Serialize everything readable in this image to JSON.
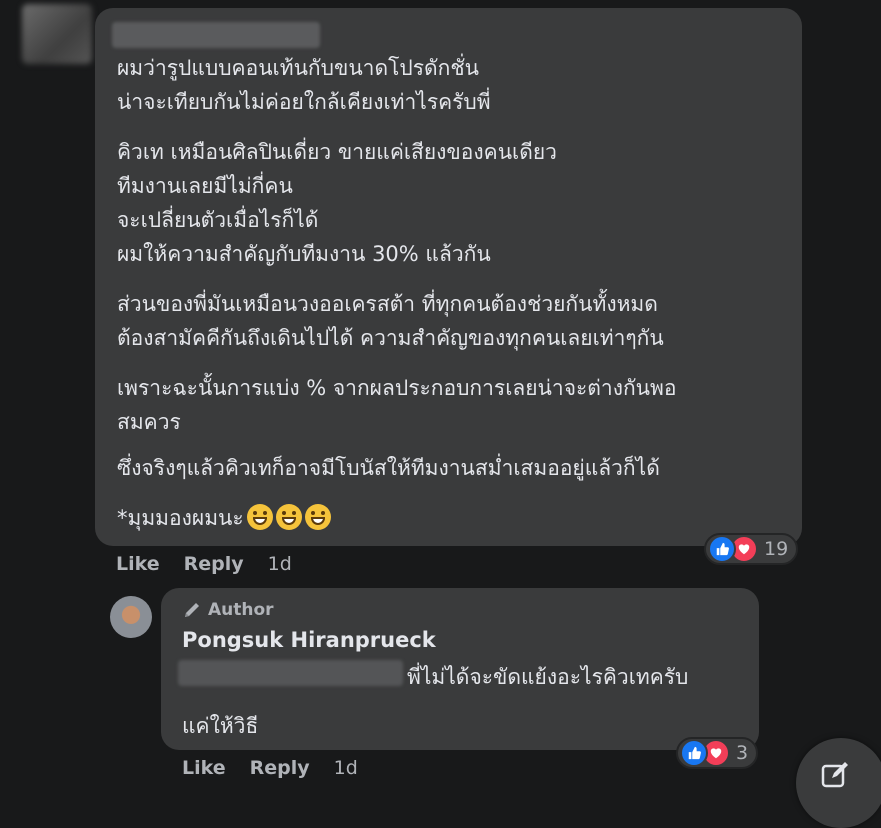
{
  "comment": {
    "paragraphs": [
      [
        "ผมว่ารูปแบบคอนเท้นกับขนาดโปรดักชั่น",
        "น่าจะเทียบกันไม่ค่อยใกล้เคียงเท่าไรครับพี่"
      ],
      [
        "คิวเท เหมือนศิลปินเดี่ยว ขายแค่เสียงของคนเดียว",
        "ทีมงานเลยมีไม่กี่คน",
        "จะเปลี่ยนตัวเมื่อไรก็ได้",
        "ผมให้ความสำคัญกับทีมงาน 30% แล้วกัน"
      ],
      [
        "ส่วนของพี่มันเหมือนวงออเครสต้า ที่ทุกคนต้องช่วยกันทั้งหมด",
        "ต้องสามัคคีกันถึงเดินไปได้ ความสำคัญของทุกคนเลยเท่าๆกัน"
      ],
      [
        "เพราะฉะนั้นการแบ่ง % จากผลประกอบการเลยน่าจะต่างกันพอ",
        "สมควร"
      ],
      [
        "ซึ่งจริงๆแล้วคิวเทก็อาจมีโบนัสให้ทีมงานสม่ำเสมออยู่แล้วก็ได้"
      ]
    ],
    "last_line": "*มุมมองผมนะ",
    "emoji": [
      "grinning-emoji",
      "grinning-emoji",
      "grinning-emoji"
    ],
    "reaction_count": "19",
    "like_label": "Like",
    "reply_label": "Reply",
    "time": "1d"
  },
  "reply": {
    "badge": "Author",
    "name": "Pongsuk Hiranprueck",
    "line1": "พี่ไม่ได้จะขัดแย้งอะไรคิวเทครับ",
    "line2": "แค่ให้วิธี",
    "reaction_count": "3",
    "like_label": "Like",
    "reply_label": "Reply",
    "time": "1d"
  },
  "colors": {
    "background": "#18191a",
    "bubble": "#3a3b3c",
    "like_blue": "#1877f2",
    "love_red": "#f33e58"
  }
}
